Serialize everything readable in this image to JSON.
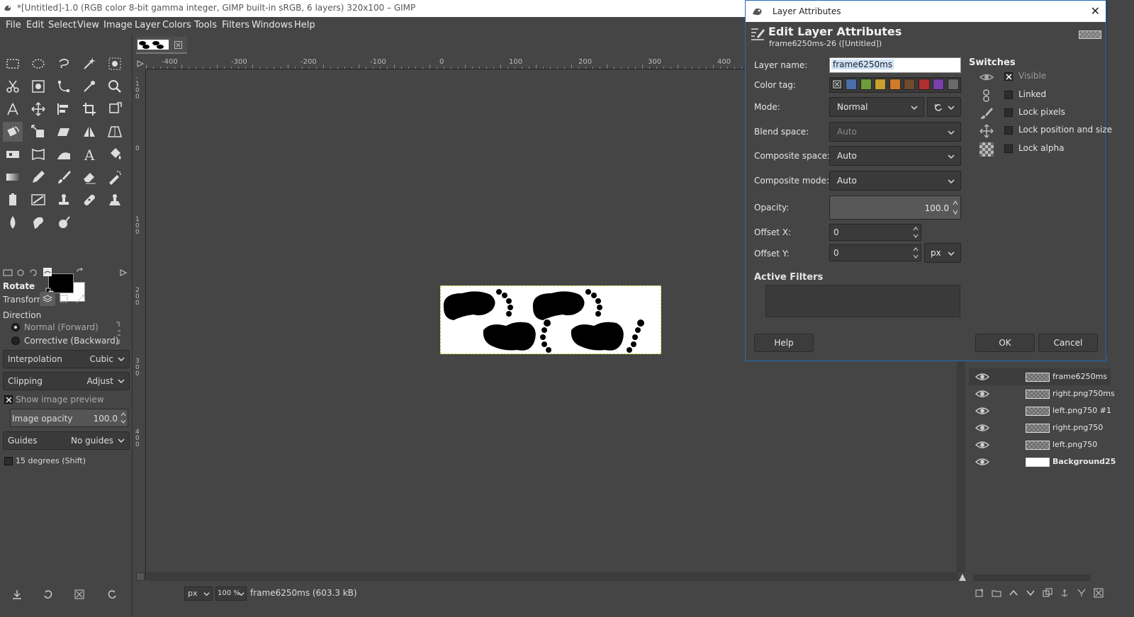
{
  "window": {
    "title": "*[Untitled]-1.0 (RGB color 8-bit gamma integer, GIMP built-in sRGB, 6 layers) 320x100 – GIMP"
  },
  "menu": [
    "File",
    "Edit",
    "Select",
    "View",
    "Image",
    "Layer",
    "Colors",
    "Tools",
    "Filters",
    "Windows",
    "Help"
  ],
  "tool_options": {
    "title": "Rotate",
    "transform_label": "Transform:",
    "direction_label": "Direction",
    "direction_options": [
      "Normal (Forward)",
      "Corrective (Backward)"
    ],
    "interpolation_label": "Interpolation",
    "interpolation_value": "Cubic",
    "clipping_label": "Clipping",
    "clipping_value": "Adjust",
    "show_preview_label": "Show image preview",
    "image_opacity_label": "Image opacity",
    "image_opacity_value": "100.0",
    "guides_label": "Guides",
    "guides_value": "No guides",
    "snap_label": "15 degrees (Shift)"
  },
  "ruler": {
    "h_labels": [
      "-400",
      "-300",
      "-200",
      "-100",
      "0",
      "100",
      "200",
      "300",
      "400"
    ],
    "v_labels": [
      "-100",
      "0",
      "100",
      "200",
      "300",
      "400"
    ]
  },
  "status": {
    "unit": "px",
    "zoom": "100 %",
    "message": "frame6250ms (603.3 kB)"
  },
  "layers": [
    {
      "name": "frame6250ms",
      "selected": true
    },
    {
      "name": "right.png750ms",
      "selected": false
    },
    {
      "name": "left.png750 #1",
      "selected": false
    },
    {
      "name": "right.png750",
      "selected": false
    },
    {
      "name": "left.png750",
      "selected": false
    },
    {
      "name": "Background25",
      "selected": false
    }
  ],
  "dialog": {
    "window_title": "Layer Attributes",
    "heading": "Edit Layer Attributes",
    "subheading": "frame6250ms-26 ([Untitled])",
    "layer_name_label": "Layer name:",
    "layer_name_value": "frame6250ms",
    "color_tag_label": "Color tag:",
    "color_tags": [
      "#4b6ea8",
      "#6e9c3b",
      "#c7a12e",
      "#d07b2a",
      "#6e4a2e",
      "#b32f2f",
      "#7a3fa8",
      "#6a6a6a"
    ],
    "mode_label": "Mode:",
    "mode_value": "Normal",
    "blend_space_label": "Blend space:",
    "blend_space_value": "Auto",
    "composite_space_label": "Composite space:",
    "composite_space_value": "Auto",
    "composite_mode_label": "Composite mode:",
    "composite_mode_value": "Auto",
    "opacity_label": "Opacity:",
    "opacity_value": "100.0",
    "offset_x_label": "Offset X:",
    "offset_x_value": "0",
    "offset_y_label": "Offset Y:",
    "offset_y_value": "0",
    "offset_unit": "px",
    "switches_title": "Switches",
    "switches": [
      {
        "label": "Visible",
        "checked": true
      },
      {
        "label": "Linked",
        "checked": false
      },
      {
        "label": "Lock pixels",
        "checked": false
      },
      {
        "label": "Lock position and size",
        "checked": false
      },
      {
        "label": "Lock alpha",
        "checked": false
      }
    ],
    "active_filters_title": "Active Filters",
    "help_label": "Help",
    "ok_label": "OK",
    "cancel_label": "Cancel"
  },
  "colors": {
    "background": "#454545",
    "accent": "#1e6ebd",
    "selection_border": "#cfcf3a"
  }
}
